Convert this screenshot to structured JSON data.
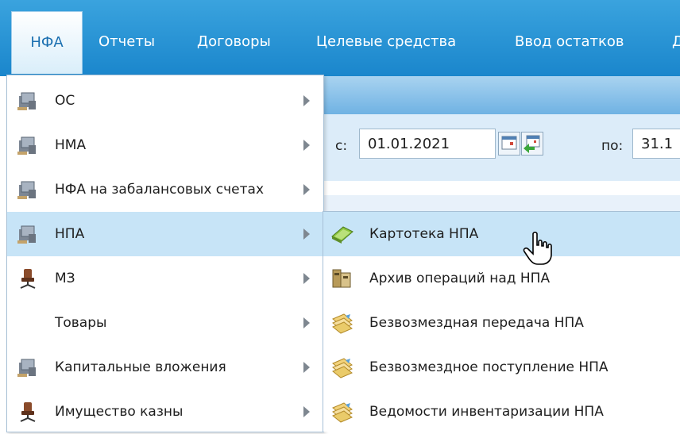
{
  "menubar": {
    "items": [
      {
        "label": "НФА",
        "active": true
      },
      {
        "label": "Отчеты"
      },
      {
        "label": "Договоры"
      },
      {
        "label": "Целевые средства"
      },
      {
        "label": "Ввод остатков"
      },
      {
        "label": "Д"
      }
    ]
  },
  "filter": {
    "from_label": "с:",
    "from_value": "01.01.2021",
    "to_label": "по:",
    "to_value": "31.1"
  },
  "menu": {
    "items": [
      {
        "label": "ОС",
        "icon": "computer-icon",
        "has_submenu": true
      },
      {
        "label": "НМА",
        "icon": "computer-icon",
        "has_submenu": true
      },
      {
        "label": "НФА на забалансовых счетах",
        "icon": "computer-icon",
        "has_submenu": true
      },
      {
        "label": "НПА",
        "icon": "computer-icon",
        "has_submenu": true,
        "highlighted": true
      },
      {
        "label": "МЗ",
        "icon": "office-chair-icon",
        "has_submenu": true
      },
      {
        "label": "Товары",
        "icon": "",
        "has_submenu": true
      },
      {
        "label": "Капитальные вложения",
        "icon": "computer-icon",
        "has_submenu": true
      },
      {
        "label": "Имущество казны",
        "icon": "office-chair-icon",
        "has_submenu": true
      }
    ]
  },
  "submenu": {
    "items": [
      {
        "label": "Картотека НПА",
        "icon": "card-file-icon",
        "highlighted": true
      },
      {
        "label": "Архив операций над НПА",
        "icon": "archive-icon"
      },
      {
        "label": "Безвозмездная передача НПА",
        "icon": "documents-icon"
      },
      {
        "label": "Безвозмездное поступление НПА",
        "icon": "documents-icon"
      },
      {
        "label": "Ведомости инвентаризации НПА",
        "icon": "documents-icon"
      }
    ]
  },
  "colors": {
    "menubar": "#1f8dd4",
    "highlight": "#c7e4f7"
  }
}
